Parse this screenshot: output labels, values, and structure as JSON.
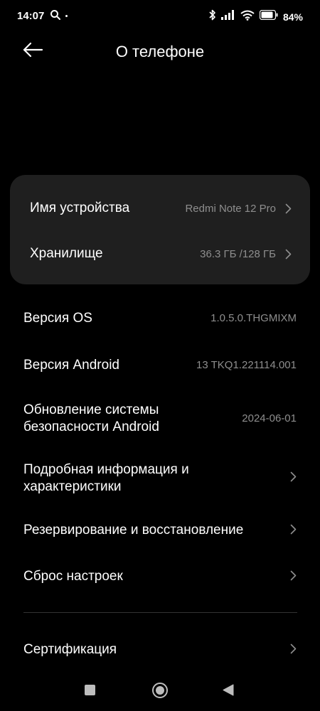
{
  "status_bar": {
    "time": "14:07",
    "battery": "84%"
  },
  "header": {
    "title": "О телефоне"
  },
  "card": [
    {
      "label": "Имя устройства",
      "value": "Redmi Note 12 Pro"
    },
    {
      "label": "Хранилище",
      "value": "36.3 ГБ /128 ГБ"
    }
  ],
  "items": {
    "os_version": {
      "label": "Версия OS",
      "value": "1.0.5.0.THGMIXM"
    },
    "android_version": {
      "label": "Версия Android",
      "value": "13 TKQ1.221114.001"
    },
    "security_update": {
      "label_line1": "Обновление системы",
      "label_line2": "безопасности Android",
      "value": "2024-06-01"
    },
    "details": {
      "label_line1": "Подробная информация и",
      "label_line2": "характеристики"
    },
    "backup": {
      "label": "Резервирование и восстановление"
    },
    "reset": {
      "label": "Сброс настроек"
    },
    "certification": {
      "label": "Сертификация"
    }
  },
  "icons": {
    "back": "arrow-left-icon",
    "chevron": "chevron-right-icon",
    "search": "search-icon",
    "bluetooth": "bluetooth-icon",
    "signal": "signal-icon",
    "wifi": "wifi-icon",
    "battery": "battery-icon"
  },
  "colors": {
    "background": "#000000",
    "card": "#1f1f1f",
    "secondary_text": "#8e8e8e"
  }
}
